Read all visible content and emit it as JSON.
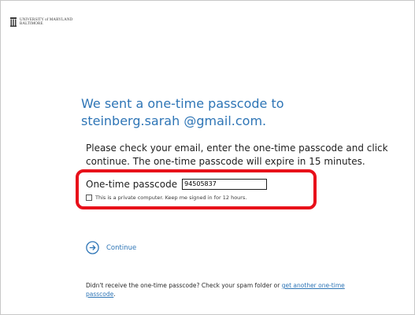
{
  "header": {
    "logo_line1": "UNIVERSITY of MARYLAND",
    "logo_line2": "BALTIMORE",
    "logo_icon": "university-crest-icon"
  },
  "main": {
    "title_line1": "We sent a one-time passcode to",
    "title_line2": "steinberg.sarah @gmail.com.",
    "instructions_line1": "Please check your email, enter the one-time passcode and click",
    "instructions_line2": "continue. The one-time passcode will expire in 15 minutes.",
    "otp_label": "One-time passcode",
    "otp_value": "94505837",
    "remember_label": "This is a private computer. Keep me signed in for 12 hours.",
    "remember_checked": false,
    "continue_label": "Continue",
    "continue_icon": "arrow-circle-right-icon"
  },
  "footer": {
    "text_before": "Didn't receive the one-time passcode? Check your spam folder or ",
    "link_part1": "get another one-time",
    "link_part2": "passcode",
    "text_after": "."
  },
  "colors": {
    "accent": "#2e75b6",
    "highlight": "#e8101a",
    "text": "#1f1f1f"
  }
}
